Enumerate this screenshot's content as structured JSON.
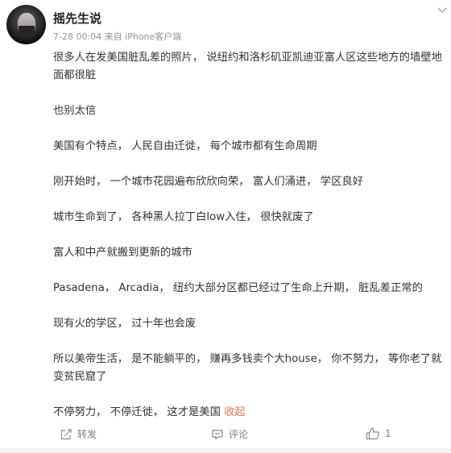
{
  "post": {
    "author": "摇先生说",
    "meta": "7-28 00:04  来自 iPhone客户端",
    "paragraphs": [
      "很多人在发美国脏乱差的照片， 说纽约和洛杉矶亚凯迪亚富人区这些地方的墙壁地面都很脏",
      "也别太信",
      "美国有个特点， 人民自由迁徙， 每个城市都有生命周期",
      "刚开始时， 一个城市花园遍布欣欣向荣， 富人们涌进， 学区良好",
      "城市生命到了， 各种黑人拉丁白low入住， 很快就废了",
      "富人和中产就搬到更新的城市",
      "Pasadena， Arcadia， 纽约大部分区都已经过了生命上升期， 脏乱差正常的",
      "现有火的学区， 过十年也会废",
      "所以美帝生活， 是不能躺平的， 赚再多钱卖个大house， 你不努力， 等你老了就变贫民窟了"
    ],
    "last_paragraph": "不停努力， 不停迁徙， 这才是美国",
    "collapse_label": "收起"
  },
  "actions": {
    "share_label": "转发",
    "comment_label": "评论",
    "like_count": "1"
  },
  "icons": {
    "menu": "chevron-down-icon",
    "share": "share-icon",
    "comment": "comment-icon",
    "like": "thumbs-up-icon"
  },
  "colors": {
    "accent": "#eb7350",
    "meta": "#939393"
  }
}
